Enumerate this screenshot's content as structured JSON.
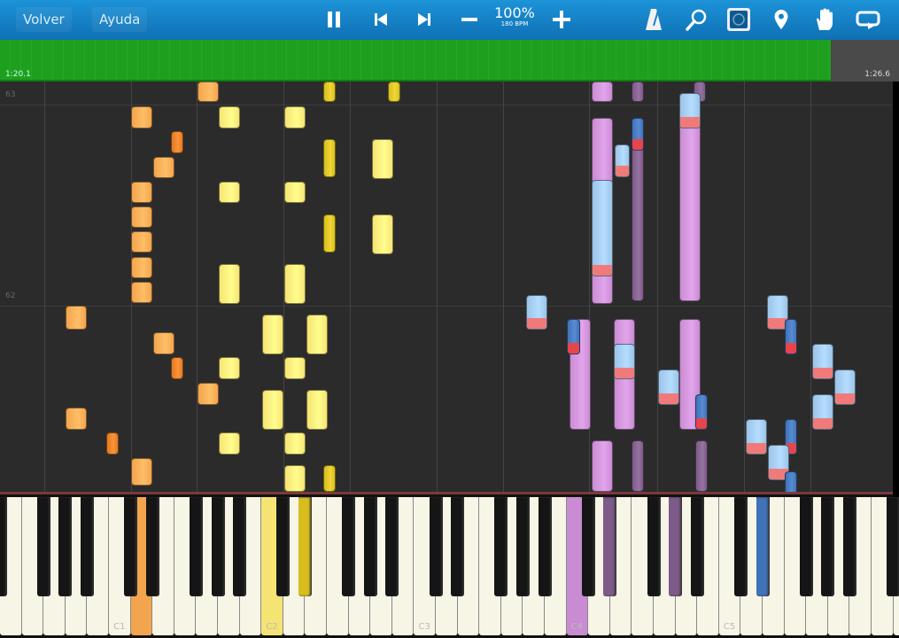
{
  "toolbar": {
    "back_label": "Volver",
    "help_label": "Ayuda",
    "speed_percent": "100%",
    "tempo": "180 BPM",
    "icons": [
      "pause-icon",
      "skip-back-icon",
      "skip-forward-icon",
      "minus-icon",
      "plus-icon",
      "metronome-icon",
      "magnifier-icon",
      "hand-select-icon",
      "location-pin-icon",
      "hand-icon",
      "loop-icon"
    ]
  },
  "timeline": {
    "current_time": "1:20.1",
    "end_time": "1:26.6",
    "progress": 0.924
  },
  "roll": {
    "measure_labels": [
      "63",
      "62"
    ]
  },
  "keyboard": {
    "octave_labels": [
      "C1",
      "C2",
      "C3",
      "C4",
      "C5"
    ],
    "pressed_keys": [
      "D1",
      "C2",
      "D#2",
      "C4",
      "D#4",
      "G#4",
      "D#5"
    ]
  },
  "colors": {
    "orange": "#f2a54e",
    "yellow": "#f5e474",
    "purple": "#c98bd2",
    "light_blue": "#9cc4e8",
    "dark_blue": "#3f72b8",
    "dark_purple": "#7d5a88",
    "toolbar": "#1783c8",
    "progress": "#22a422"
  }
}
